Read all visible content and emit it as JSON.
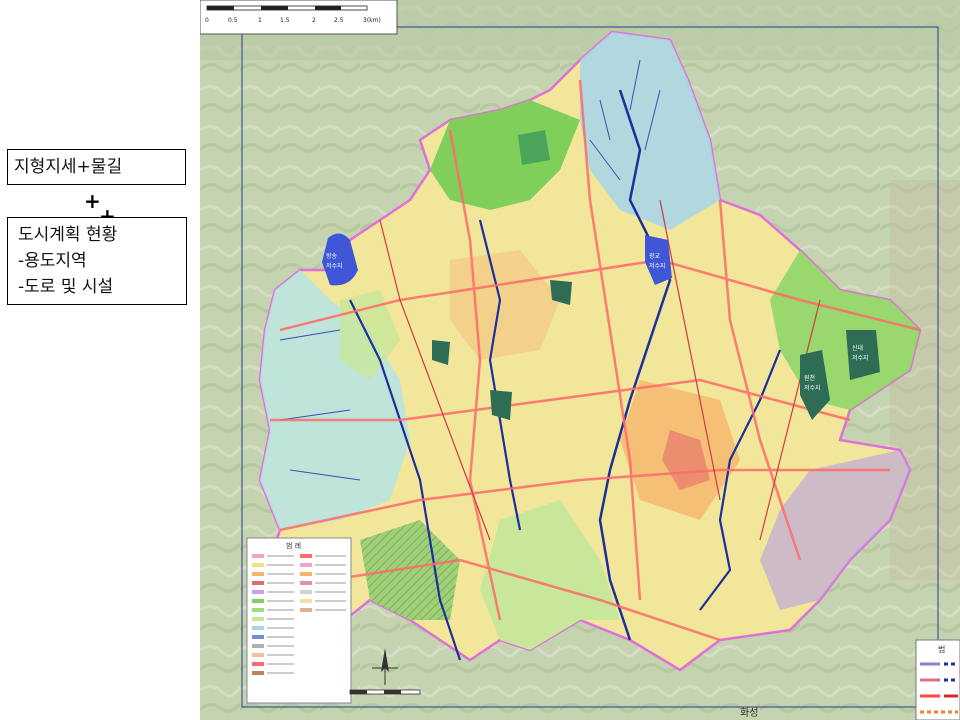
{
  "left_panel": {
    "box1": "지형지세+물길",
    "plus1": "+",
    "plus2": "+",
    "box2_lines": [
      "도시계획 현황",
      "-용도지역",
      "-도로 및 시설"
    ]
  },
  "map": {
    "scale_bar": {
      "ticks": [
        "0",
        "0.5",
        "1",
        "1.5",
        "2",
        "2.5",
        "3(km)"
      ]
    },
    "reservoirs": [
      {
        "name": "왕송\n저수지",
        "color": "#3f57d6"
      },
      {
        "name": "광교\n저수지",
        "color": "#3f57d6"
      },
      {
        "name": "원천\n저수지",
        "color": "#2e6c55"
      },
      {
        "name": "신대\n저수지",
        "color": "#2e6c55"
      },
      {
        "name": "파장\n저수지",
        "color": "#2e6c55"
      }
    ],
    "edge_labels": {
      "bottom": "화성"
    },
    "legend_title": "범 례",
    "right_legend_title": "범",
    "colors": {
      "boundary": "#e070d8",
      "road": "#ff6a6a",
      "stream_dark": "#1d2f9a",
      "mountain_green": "#7fcf5a",
      "urban_yellow": "#f3e27a",
      "residential_orange": "#f6b36a",
      "outside_terrain": "#c9d7b9",
      "water_blue": "#3f57d6"
    }
  }
}
